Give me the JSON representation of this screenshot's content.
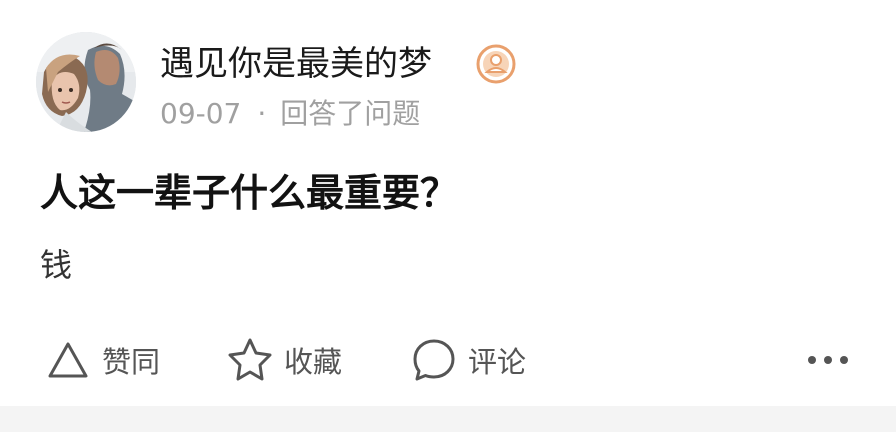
{
  "author": {
    "name": "遇见你是最美的梦",
    "avatar_icon": "avatar",
    "badge_icon": "user-badge-icon",
    "badge_color": "#e9a06d"
  },
  "meta": {
    "date": "09-07",
    "separator": "·",
    "action": "回答了问题"
  },
  "question": {
    "title": "人这一辈子什么最重要？"
  },
  "answer": {
    "text": "钱"
  },
  "actions": [
    {
      "label": "赞同",
      "icon": "upvote-triangle-icon"
    },
    {
      "label": "收藏",
      "icon": "star-icon"
    },
    {
      "label": "评论",
      "icon": "comment-bubble-icon"
    }
  ],
  "more_icon": "more-dots-icon",
  "colors": {
    "icon_gray": "#555555",
    "meta_gray": "#a0a0a0",
    "text_dark": "#1a1a1a"
  }
}
